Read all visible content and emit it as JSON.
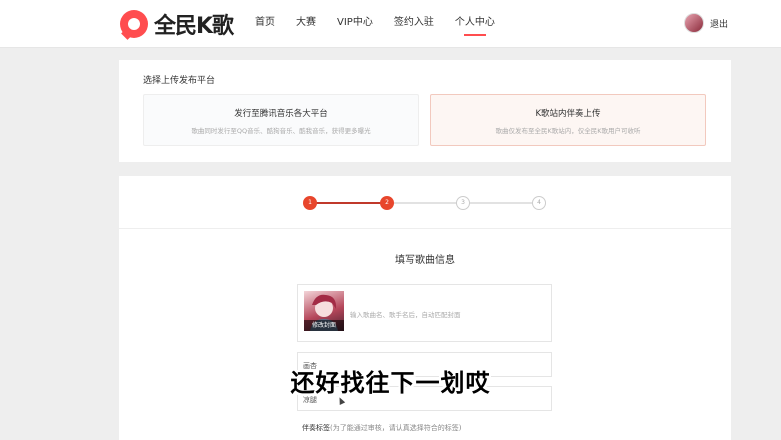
{
  "header": {
    "logo_text": "全民K歌",
    "nav": [
      {
        "label": "首页"
      },
      {
        "label": "大赛"
      },
      {
        "label": "VIP中心"
      },
      {
        "label": "签约入驻"
      },
      {
        "label": "个人中心",
        "active": true
      }
    ],
    "logout": "退出"
  },
  "platform": {
    "title": "选择上传发布平台",
    "options": [
      {
        "title": "发行至腾讯音乐各大平台",
        "desc": "歌曲同时发行至QQ音乐、酷狗音乐、酷我音乐，获得更多曝光",
        "selected": false
      },
      {
        "title": "K歌站内伴奏上传",
        "desc": "歌曲仅发布至全民K歌站内，仅全民K歌用户可收听",
        "selected": true
      }
    ]
  },
  "steps": {
    "items": [
      "1",
      "2",
      "3",
      "4"
    ],
    "current": 2
  },
  "form": {
    "title": "填写歌曲信息",
    "cover_label": "修改封面",
    "song_placeholder": "输入歌曲名、歌手名后，自动匹配封面",
    "fields": [
      {
        "label": "画杏"
      },
      {
        "label": "凉腿"
      }
    ],
    "tag_label": "伴奏标签",
    "tag_hint": "(为了能通过审核，请认真选择符合的标签)"
  },
  "subtitle": "还好找往下一划哎",
  "colors": {
    "accent": "#e8462c",
    "brand": "#ff4d4f"
  }
}
